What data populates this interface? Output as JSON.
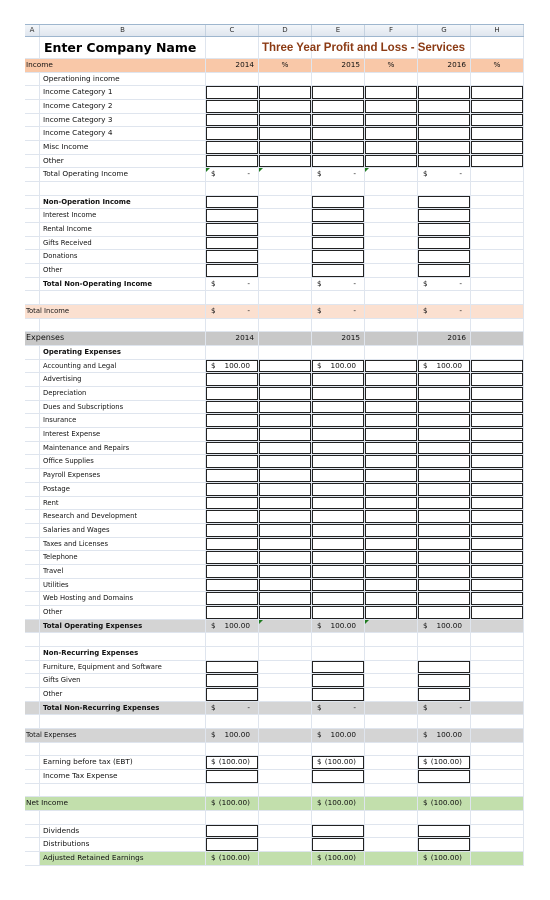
{
  "columns": [
    "A",
    "B",
    "C",
    "D",
    "E",
    "F",
    "G",
    "H"
  ],
  "header": {
    "company_name": "Enter Company Name",
    "report_title": "Three Year Profit and Loss - Services"
  },
  "colors": {
    "title": "#8b3a13",
    "income_band": "#f9c8a8",
    "total_income_band": "#fbe0d0",
    "expenses_band": "#c8c8c8",
    "totals_band": "#d4d4d4",
    "net_band": "#c2dfac"
  },
  "income": {
    "section_label": "Income",
    "years": [
      "2014",
      "2015",
      "2016"
    ],
    "pct_label": "%",
    "operating_header": "Operationing income",
    "operating_items": [
      "Income Category 1",
      "Income Category 2",
      "Income Category 3",
      "Income Category 4",
      "Misc Income",
      "Other"
    ],
    "operating_total_label": "Total Operating Income",
    "operating_totals": [
      {
        "cur": "$",
        "val": "-"
      },
      {
        "cur": "$",
        "val": "-"
      },
      {
        "cur": "$",
        "val": "-"
      }
    ],
    "non_operating_header": "Non-Operation Income",
    "non_operating_items": [
      "Interest Income",
      "Rental Income",
      "Gifts Received",
      "Donations",
      "Other"
    ],
    "non_operating_total_label": "Total Non-Operating Income",
    "non_operating_totals": [
      {
        "cur": "$",
        "val": "-"
      },
      {
        "cur": "$",
        "val": "-"
      },
      {
        "cur": "$",
        "val": "-"
      }
    ],
    "total_label": "Total Income",
    "totals": [
      {
        "cur": "$",
        "val": "-"
      },
      {
        "cur": "$",
        "val": "-"
      },
      {
        "cur": "$",
        "val": "-"
      }
    ]
  },
  "expenses": {
    "section_label": "Expenses",
    "years": [
      "2014",
      "2015",
      "2016"
    ],
    "operating_header": "Operating Expenses",
    "operating_items": [
      {
        "label": "Accounting and Legal",
        "values": [
          {
            "cur": "$",
            "val": "100.00"
          },
          {
            "cur": "$",
            "val": "100.00"
          },
          {
            "cur": "$",
            "val": "100.00"
          }
        ]
      },
      {
        "label": "Advertising"
      },
      {
        "label": "Depreciation"
      },
      {
        "label": "Dues and Subscriptions"
      },
      {
        "label": "Insurance"
      },
      {
        "label": "Interest Expense"
      },
      {
        "label": "Maintenance and Repairs"
      },
      {
        "label": "Office Supplies"
      },
      {
        "label": "Payroll Expenses"
      },
      {
        "label": "Postage"
      },
      {
        "label": "Rent"
      },
      {
        "label": "Research and Development"
      },
      {
        "label": "Salaries and Wages"
      },
      {
        "label": "Taxes and Licenses"
      },
      {
        "label": "Telephone"
      },
      {
        "label": "Travel"
      },
      {
        "label": "Utilities"
      },
      {
        "label": "Web Hosting and Domains"
      },
      {
        "label": "Other"
      }
    ],
    "operating_total_label": "Total Operating Expenses",
    "operating_totals": [
      {
        "cur": "$",
        "val": "100.00"
      },
      {
        "cur": "$",
        "val": "100.00"
      },
      {
        "cur": "$",
        "val": "100.00"
      }
    ],
    "non_recurring_header": "Non-Recurring Expenses",
    "non_recurring_items": [
      "Furniture, Equipment and Software",
      "Gifts Given",
      "Other"
    ],
    "non_recurring_total_label": "Total Non-Recurring Expenses",
    "non_recurring_totals": [
      {
        "cur": "$",
        "val": "-"
      },
      {
        "cur": "$",
        "val": "-"
      },
      {
        "cur": "$",
        "val": "-"
      }
    ],
    "total_label": "Total Expenses",
    "totals": [
      {
        "cur": "$",
        "val": "100.00"
      },
      {
        "cur": "$",
        "val": "100.00"
      },
      {
        "cur": "$",
        "val": "100.00"
      }
    ]
  },
  "summary": {
    "ebt_label": "Earning before tax (EBT)",
    "ebt_values": [
      {
        "cur": "$",
        "val": "(100.00)"
      },
      {
        "cur": "$",
        "val": "(100.00)"
      },
      {
        "cur": "$",
        "val": "(100.00)"
      }
    ],
    "tax_label": "Income Tax Expense",
    "net_income_label": "Net Income",
    "net_income_values": [
      {
        "cur": "$",
        "val": "(100.00)"
      },
      {
        "cur": "$",
        "val": "(100.00)"
      },
      {
        "cur": "$",
        "val": "(100.00)"
      }
    ],
    "dividends_label": "Dividends",
    "distributions_label": "Distributions",
    "are_label": "Adjusted Retained Earnings",
    "are_values": [
      {
        "cur": "$",
        "val": "(100.00)"
      },
      {
        "cur": "$",
        "val": "(100.00)"
      },
      {
        "cur": "$",
        "val": "(100.00)"
      }
    ]
  }
}
